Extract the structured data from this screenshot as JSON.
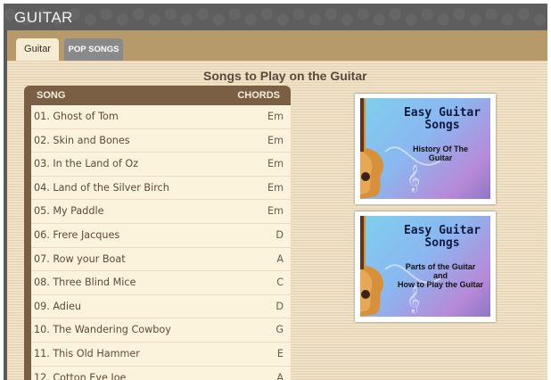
{
  "app": {
    "title": "GUITAR"
  },
  "tabs": [
    {
      "label": "Guitar",
      "active": true
    },
    {
      "label": "POP SONGS",
      "active": false
    }
  ],
  "section": {
    "title": "Songs to Play on the Guitar"
  },
  "song_list": {
    "headers": {
      "song": "SONG",
      "chords": "CHORDS"
    },
    "rows": [
      {
        "song": "01. Ghost of Tom",
        "chord": "Em"
      },
      {
        "song": "02. Skin and Bones",
        "chord": "Em"
      },
      {
        "song": "03. In the Land of Oz",
        "chord": "Em"
      },
      {
        "song": "04. Land of the Silver Birch",
        "chord": "Em"
      },
      {
        "song": "05. My Paddle",
        "chord": "Em"
      },
      {
        "song": "06. Frere Jacques",
        "chord": "D"
      },
      {
        "song": "07. Row your Boat",
        "chord": "A"
      },
      {
        "song": "08. Three Blind Mice",
        "chord": "C"
      },
      {
        "song": "09. Adieu",
        "chord": "D"
      },
      {
        "song": "10. The Wandering Cowboy",
        "chord": "G"
      },
      {
        "song": "11. This Old Hammer",
        "chord": "E"
      },
      {
        "song": "12. Cotton Eye Joe",
        "chord": "A"
      }
    ]
  },
  "covers": [
    {
      "title_line1": "Easy Guitar",
      "title_line2": "Songs",
      "subtitle_line1": "History Of The",
      "subtitle_line2": "Guitar"
    },
    {
      "title_line1": "Easy Guitar",
      "title_line2": "Songs",
      "subtitle_line1": "Parts of the Guitar",
      "subtitle_line2": "and",
      "subtitle_line3": "How to Play the Guitar"
    }
  ],
  "colors": {
    "panel": "#7b5f45",
    "tabbar": "#b69a6a",
    "row": "#fbf3dc",
    "titlebar": "#5e5e5e"
  }
}
